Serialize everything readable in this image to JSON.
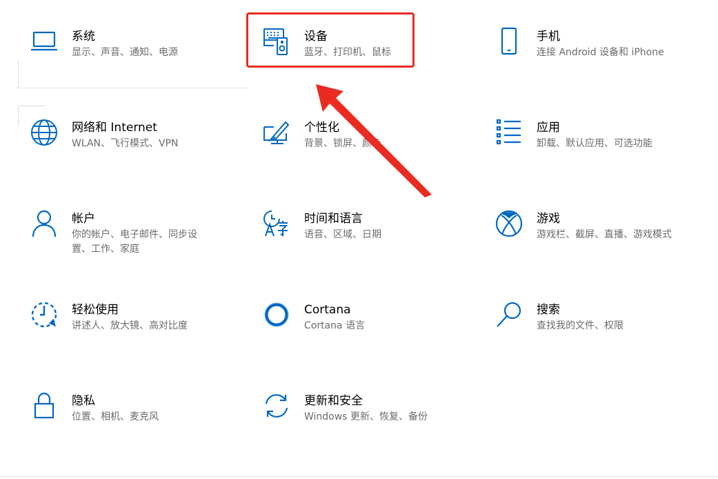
{
  "accent": "#0067c0",
  "annotation_color": "#ea2b21",
  "tiles": [
    {
      "icon": "laptop-icon",
      "title": "系统",
      "desc": "显示、声音、通知、电源"
    },
    {
      "icon": "devices-icon",
      "title": "设备",
      "desc": "蓝牙、打印机、鼠标"
    },
    {
      "icon": "phone-icon",
      "title": "手机",
      "desc": "连接 Android 设备和 iPhone"
    },
    {
      "icon": "globe-icon",
      "title": "网络和 Internet",
      "desc": "WLAN、飞行模式、VPN"
    },
    {
      "icon": "personalization-icon",
      "title": "个性化",
      "desc": "背景、锁屏、颜色"
    },
    {
      "icon": "apps-list-icon",
      "title": "应用",
      "desc": "卸载、默认应用、可选功能"
    },
    {
      "icon": "person-icon",
      "title": "帐户",
      "desc": "你的帐户、电子邮件、同步设置、工作、家庭"
    },
    {
      "icon": "time-language-icon",
      "title": "时间和语言",
      "desc": "语音、区域、日期"
    },
    {
      "icon": "xbox-icon",
      "title": "游戏",
      "desc": "游戏栏、截屏、直播、游戏模式"
    },
    {
      "icon": "ease-of-access-icon",
      "title": "轻松使用",
      "desc": "讲述人、放大镜、高对比度"
    },
    {
      "icon": "cortana-icon",
      "title": "Cortana",
      "desc": "Cortana 语言"
    },
    {
      "icon": "search-icon",
      "title": "搜索",
      "desc": "查找我的文件、权限"
    },
    {
      "icon": "lock-icon",
      "title": "隐私",
      "desc": "位置、相机、麦克风"
    },
    {
      "icon": "sync-icon",
      "title": "更新和安全",
      "desc": "Windows 更新、恢复、备份"
    }
  ]
}
